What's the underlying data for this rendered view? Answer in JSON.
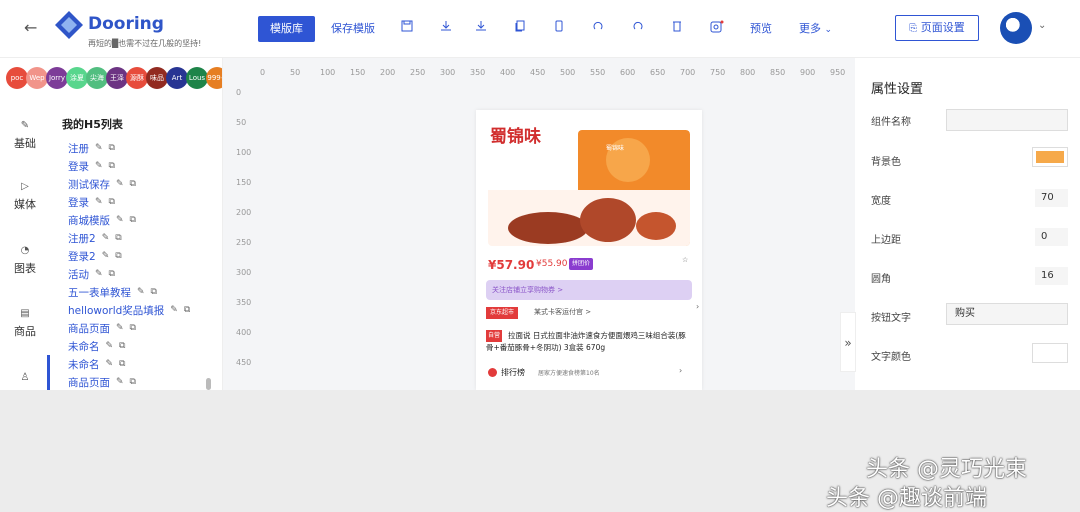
{
  "header": {
    "brand": "Dooring",
    "slogan": "再短的█也需不过在几般的坚持!",
    "template_library": "模版库",
    "save_template": "保存模版",
    "preview": "预览",
    "more": "更多",
    "page_settings": "页面设置"
  },
  "collaborators": [
    {
      "label": "poc",
      "color": "#e74c3c"
    },
    {
      "label": "Wep",
      "color": "#f1948a"
    },
    {
      "label": "Jorry",
      "color": "#7d3c98"
    },
    {
      "label": "涂夏",
      "color": "#58d68d"
    },
    {
      "label": "尖海",
      "color": "#52be80"
    },
    {
      "label": "王泽",
      "color": "#6c3483"
    },
    {
      "label": "源酥",
      "color": "#e74c3c"
    },
    {
      "label": "味品",
      "color": "#922b21"
    },
    {
      "label": "Art",
      "color": "#283593"
    },
    {
      "label": "Lous",
      "color": "#1e8449"
    },
    {
      "label": "999+",
      "color": "#e67e22"
    }
  ],
  "leftnav": [
    {
      "label": "基础",
      "icon": "pen-icon"
    },
    {
      "label": "媒体",
      "icon": "play-icon"
    },
    {
      "label": "图表",
      "icon": "pie-chart-icon"
    },
    {
      "label": "商品",
      "icon": "shop-icon"
    },
    {
      "label": "",
      "icon": "user-icon"
    }
  ],
  "panel": {
    "title": "我的H5列表",
    "items": [
      "注册",
      "登录",
      "测试保存",
      "登录",
      "商城模版",
      "注册2",
      "登录2",
      "活动",
      "五一表单教程",
      "helloworld奖品填报",
      "商品页面",
      "未命名",
      "未命名",
      "商品页面"
    ]
  },
  "ruler": {
    "top": [
      "0",
      "50",
      "100",
      "150",
      "200",
      "250",
      "300",
      "350",
      "400",
      "450",
      "500",
      "550",
      "600",
      "650",
      "700",
      "750",
      "800",
      "850",
      "900",
      "950"
    ],
    "left": [
      "0",
      "50",
      "100",
      "150",
      "200",
      "250",
      "300",
      "350",
      "400",
      "450"
    ]
  },
  "phone": {
    "brand": "蜀锦味",
    "image_tag": "蜀锦味",
    "price": "¥57.90",
    "orig_price": "¥55.90",
    "price_tag": "拼团价",
    "buy_bar": "关注店铺立享购物券 >",
    "shop_tag": "京东超市",
    "shop_text": "某式卡客运付官 >",
    "hot_tag": "自营",
    "desc": "拉面说 日式拉面非油炸速食方便面煨鸡三味组合装(豚骨+番茄豚骨+冬阴功) 3盒装 670g",
    "rank": "排行榜",
    "rank_text": "居家方便速食榜第10名"
  },
  "props": {
    "title": "属性设置",
    "component_name_label": "组件名称",
    "component_name_value": "",
    "bg_color_label": "背景色",
    "bg_color": "#f6a94a",
    "width_label": "宽度",
    "width_value": "70",
    "margin_top_label": "上边距",
    "margin_top_value": "0",
    "radius_label": "圆角",
    "radius_value": "16",
    "button_text_label": "按钮文字",
    "button_text_value": "购买",
    "text_color_label": "文字颜色",
    "text_color": "#ffffff"
  },
  "watermark": {
    "line1": "头条 @灵巧光束",
    "line2": "头条 @趣谈前端"
  }
}
